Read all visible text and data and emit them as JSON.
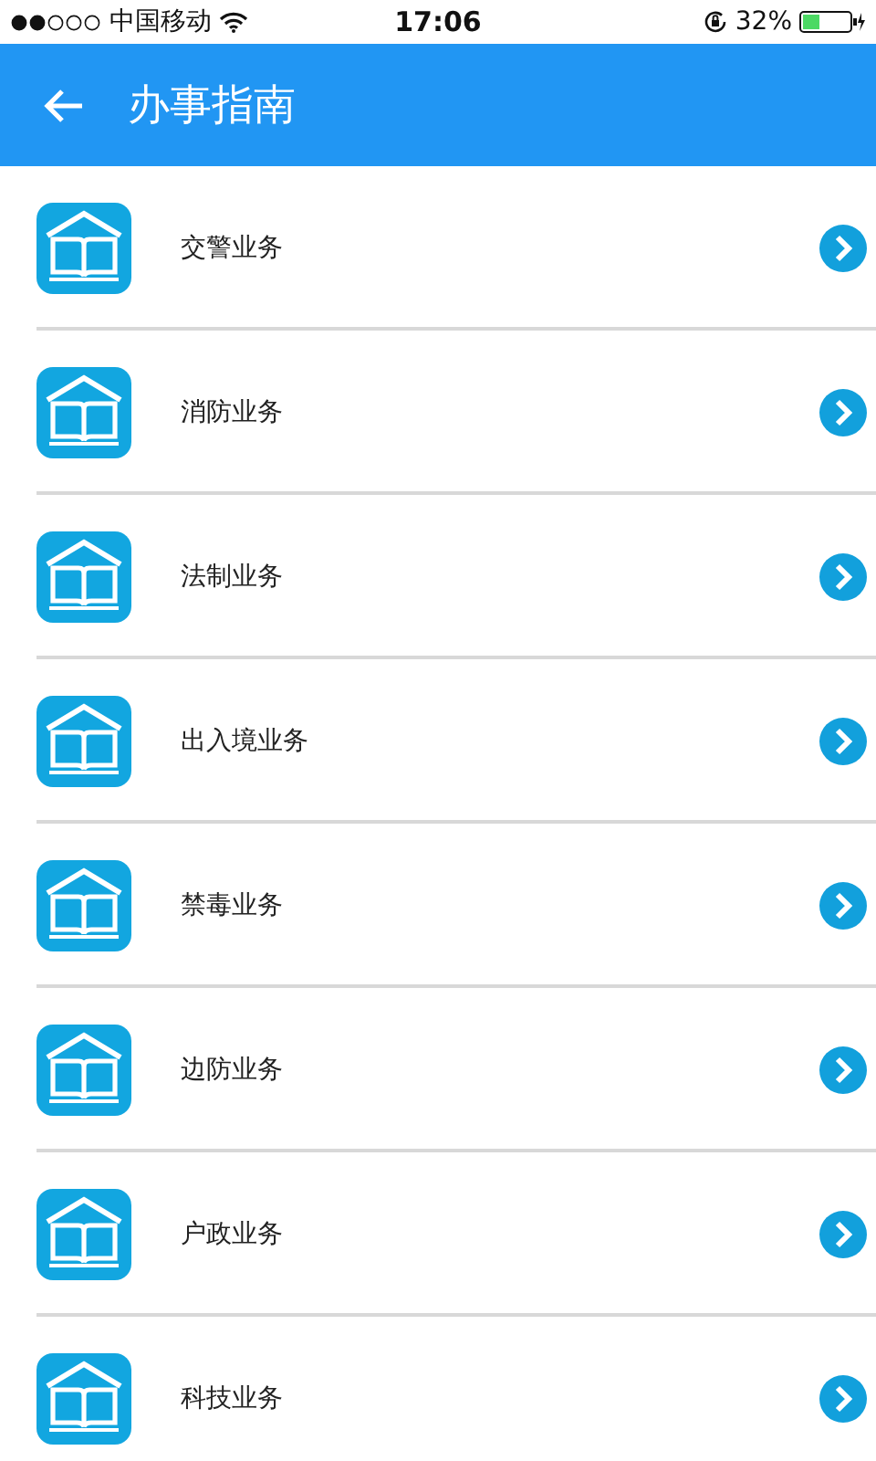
{
  "status_bar": {
    "carrier": "中国移动",
    "time": "17:06",
    "battery_text": "32%"
  },
  "header": {
    "title": "办事指南"
  },
  "items": [
    {
      "label": "交警业务"
    },
    {
      "label": "消防业务"
    },
    {
      "label": "法制业务"
    },
    {
      "label": "出入境业务"
    },
    {
      "label": "禁毒业务"
    },
    {
      "label": "边防业务"
    },
    {
      "label": "户政业务"
    },
    {
      "label": "科技业务"
    }
  ]
}
